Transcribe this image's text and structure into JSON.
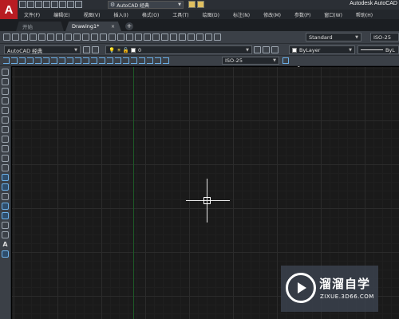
{
  "app": {
    "logo_letter": "A",
    "title": "Autodesk AutoCAD",
    "workspace": "AutoCAD 经典"
  },
  "menu": [
    "文件(F)",
    "编辑(E)",
    "视图(V)",
    "插入(I)",
    "格式(O)",
    "工具(T)",
    "绘图(D)",
    "标注(N)",
    "修改(M)",
    "参数(P)",
    "窗口(W)",
    "帮助(H)"
  ],
  "tabs": [
    {
      "label": "开始",
      "active": false
    },
    {
      "label": "Drawing1*",
      "active": true
    }
  ],
  "tab_add": "+",
  "tab_close": "×",
  "toolbar": {
    "text_style_icon": "A",
    "text_style": "Standard",
    "dim_style_right": "ISO-25",
    "workspace2": "AutoCAD 经典",
    "layer": "0",
    "color": "ByLayer",
    "linetype": "ByL",
    "dim_style": "ISO-25"
  },
  "palette_text_tool": "A",
  "watermark": {
    "brand": "溜溜自学",
    "url": "ZIXUE.3D66.COM"
  },
  "colors": {
    "logo": "#b81c22",
    "canvas": "#1a1a1a",
    "y_axis": "#1d5a27",
    "toolbar": "#3b4047"
  }
}
